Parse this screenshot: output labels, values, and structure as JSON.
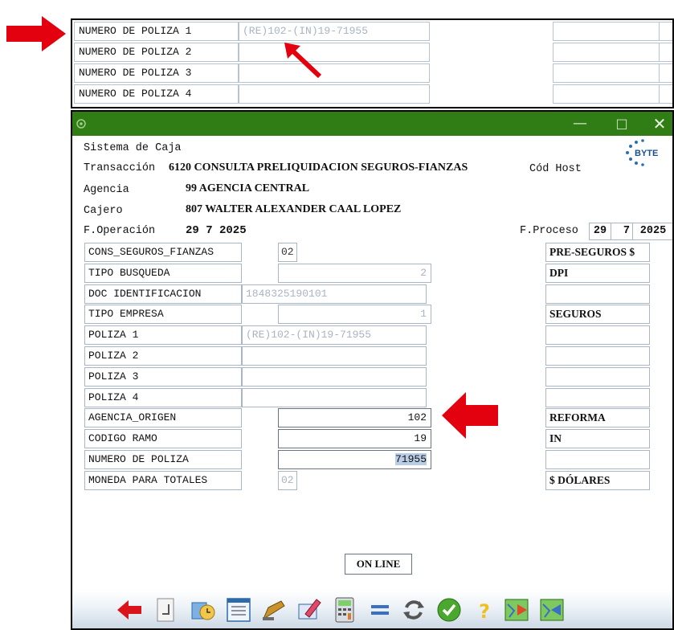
{
  "excerpt": {
    "rows": [
      {
        "label": "NUMERO DE POLIZA 1",
        "value": "(RE)102-(IN)19-71955"
      },
      {
        "label": "NUMERO DE POLIZA 2",
        "value": ""
      },
      {
        "label": "NUMERO DE POLIZA 3",
        "value": ""
      },
      {
        "label": "NUMERO DE POLIZA 4",
        "value": ""
      }
    ]
  },
  "window": {
    "title_buttons": {
      "minimize": "—",
      "maximize": "□",
      "close": "✕"
    },
    "header": {
      "system": "Sistema de Caja",
      "transaction_label": "Transacción",
      "transaction_value": "6120 CONSULTA PRELIQUIDACION SEGUROS-FIANZAS",
      "host_label": "Cód Host",
      "agency_label": "Agencia",
      "agency_value": "99 AGENCIA CENTRAL",
      "cashier_label": "Cajero",
      "cashier_value": "807 WALTER ALEXANDER CAAL LOPEZ",
      "op_date_label": "F.Operación",
      "op_date_value": "29  7 2025",
      "proc_date_label": "F.Proceso",
      "proc_day": "29",
      "proc_month": "7",
      "proc_year": "2025"
    },
    "form": [
      {
        "label": "CONS_SEGUROS_FIANZAS",
        "value": "02",
        "right": "PRE-SEGUROS $"
      },
      {
        "label": "TIPO BUSQUEDA",
        "value": "2",
        "right": "DPI"
      },
      {
        "label": "DOC IDENTIFICACION",
        "value": "1848325190101",
        "right": ""
      },
      {
        "label": "TIPO EMPRESA",
        "value": "1",
        "right": "SEGUROS"
      },
      {
        "label": "POLIZA 1",
        "value": "(RE)102-(IN)19-71955",
        "right": ""
      },
      {
        "label": "POLIZA 2",
        "value": "",
        "right": ""
      },
      {
        "label": "POLIZA 3",
        "value": "",
        "right": ""
      },
      {
        "label": "POLIZA 4",
        "value": "",
        "right": ""
      },
      {
        "label": "AGENCIA_ORIGEN",
        "value": "102",
        "right": "REFORMA"
      },
      {
        "label": "CODIGO RAMO",
        "value": "19",
        "right": "IN"
      },
      {
        "label": "NUMERO DE POLIZA",
        "value": "71955",
        "right": ""
      },
      {
        "label": "MONEDA PARA TOTALES",
        "value": "02",
        "right": "$ DÓLARES"
      }
    ],
    "status": "ON LINE",
    "logo_text": "BYTE"
  },
  "colors": {
    "titlebar": "#2f7d14",
    "arrow": "#e3000f",
    "field_border": "#a9b6c5",
    "placeholder_text": "#a8b4c4"
  }
}
